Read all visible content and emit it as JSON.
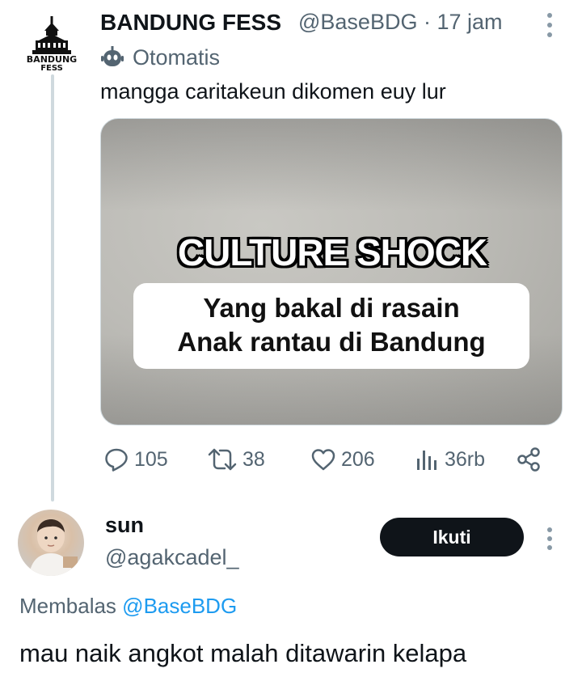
{
  "tweet": {
    "author_name": "BANDUNG FESS",
    "handle": "@BaseBDG",
    "separator": "·",
    "time": "17 jam",
    "automated_label": "Otomatis",
    "text": "mangga caritakeun dikomen euy lur",
    "logo_text_line1": "BANDUNG",
    "logo_text_line2": "FESS",
    "media": {
      "headline": "CULTURE SHOCK",
      "caption_line1": "Yang bakal di rasain",
      "caption_line2": "Anak rantau di Bandung"
    },
    "actions": {
      "replies": "105",
      "reposts": "38",
      "likes": "206",
      "views": "36rb"
    }
  },
  "reply": {
    "author_name": "sun",
    "handle": "@agakcadel_",
    "follow_label": "Ikuti",
    "replying_prefix": "Membalas",
    "replying_to": "@BaseBDG",
    "text": "mau naik angkot malah ditawarin kelapa"
  },
  "colors": {
    "secondary_text": "#536471",
    "accent": "#1d9bf0",
    "button_bg": "#0f1419",
    "thread_line": "#cfd9de"
  },
  "icons": [
    "reply-icon",
    "repost-icon",
    "like-icon",
    "views-icon",
    "share-icon",
    "robot-icon",
    "more-icon"
  ]
}
